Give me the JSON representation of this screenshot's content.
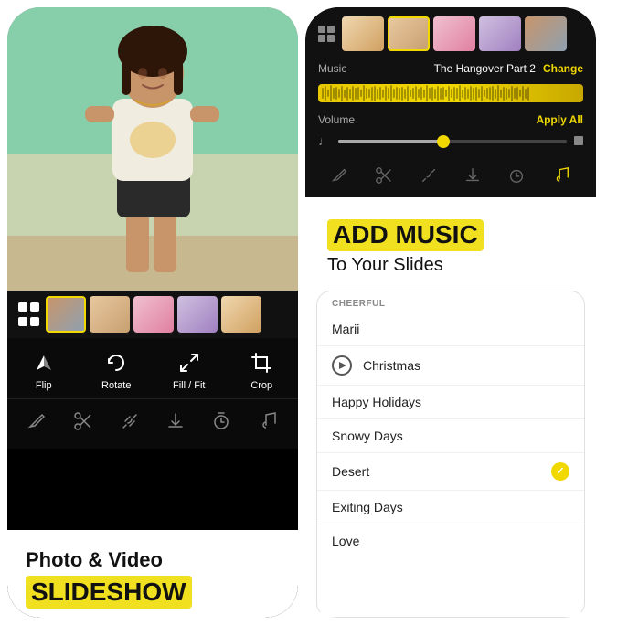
{
  "left_phone": {
    "controls": [
      {
        "id": "flip",
        "label": "Flip",
        "icon": "flip"
      },
      {
        "id": "rotate",
        "label": "Rotate",
        "icon": "rotate"
      },
      {
        "id": "fill_fit",
        "label": "Fill / Fit",
        "icon": "fill_fit"
      },
      {
        "id": "crop",
        "label": "Crop",
        "icon": "crop"
      }
    ],
    "bottom_text": {
      "line1": "Photo & Video",
      "line2": "SLIDESHOW"
    }
  },
  "right_phone": {
    "music_bar": {
      "label": "Music",
      "title": "The Hangover Part 2",
      "change_label": "Change"
    },
    "volume_bar": {
      "label": "Volume",
      "apply_label": "Apply All"
    },
    "add_music": {
      "title_highlight": "ADD MUSIC",
      "title_sub": "To Your Slides"
    },
    "music_category": "CHEERFUL",
    "music_items": [
      {
        "id": "marii",
        "name": "Marii",
        "playing": false,
        "selected": false
      },
      {
        "id": "christmas",
        "name": "Christmas",
        "playing": true,
        "selected": false
      },
      {
        "id": "happy_holidays",
        "name": "Happy Holidays",
        "playing": false,
        "selected": false
      },
      {
        "id": "snowy_days",
        "name": "Snowy Days",
        "playing": false,
        "selected": false
      },
      {
        "id": "desert",
        "name": "Desert",
        "playing": false,
        "selected": true
      },
      {
        "id": "exiting_days",
        "name": "Exiting Days",
        "playing": false,
        "selected": false
      },
      {
        "id": "love",
        "name": "Love",
        "playing": false,
        "selected": false
      }
    ]
  }
}
